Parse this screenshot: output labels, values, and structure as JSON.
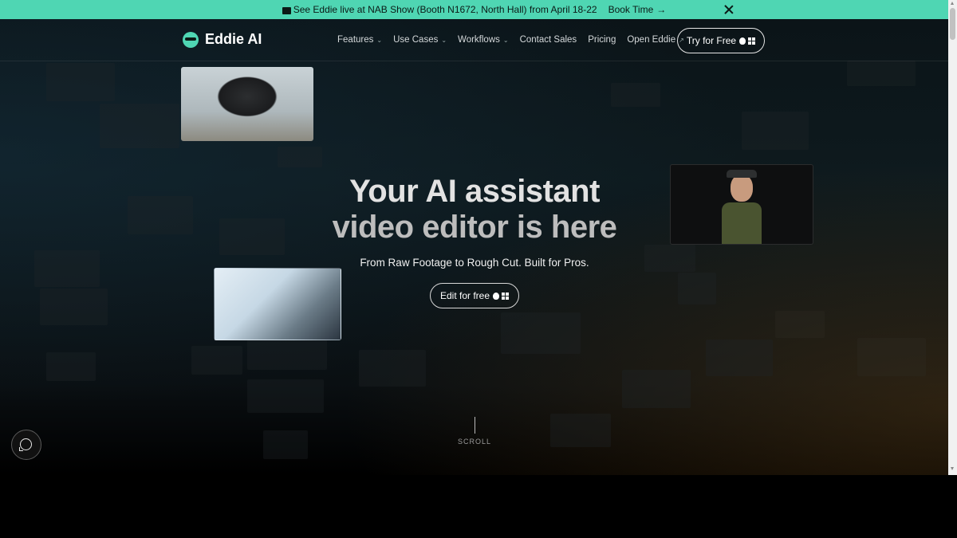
{
  "banner": {
    "icon": "clapperboard-icon",
    "text": "See Eddie live at NAB Show (Booth N1672, North Hall) from April 18-22",
    "link_label": "Book Time",
    "link_arrow": "→",
    "close_icon": "close-icon"
  },
  "nav": {
    "brand": "Eddie AI",
    "links": [
      {
        "label": "Features",
        "chevron": "⌄"
      },
      {
        "label": "Use Cases",
        "chevron": "⌄"
      },
      {
        "label": "Workflows",
        "chevron": "⌄"
      },
      {
        "label": "Contact Sales",
        "chevron": ""
      },
      {
        "label": "Pricing",
        "chevron": ""
      },
      {
        "label": "Open Eddie",
        "chevron": "↗"
      }
    ],
    "cta_label": "Try for Free"
  },
  "hero": {
    "title_line1": "Your AI assistant",
    "title_line2": "video editor is here",
    "subtitle": "From Raw Footage to Rough Cut. Built for Pros.",
    "cta_label": "Edit for free",
    "scroll_label": "SCROLL"
  },
  "colors": {
    "accent": "#4fd6b3",
    "background": "#000000"
  }
}
